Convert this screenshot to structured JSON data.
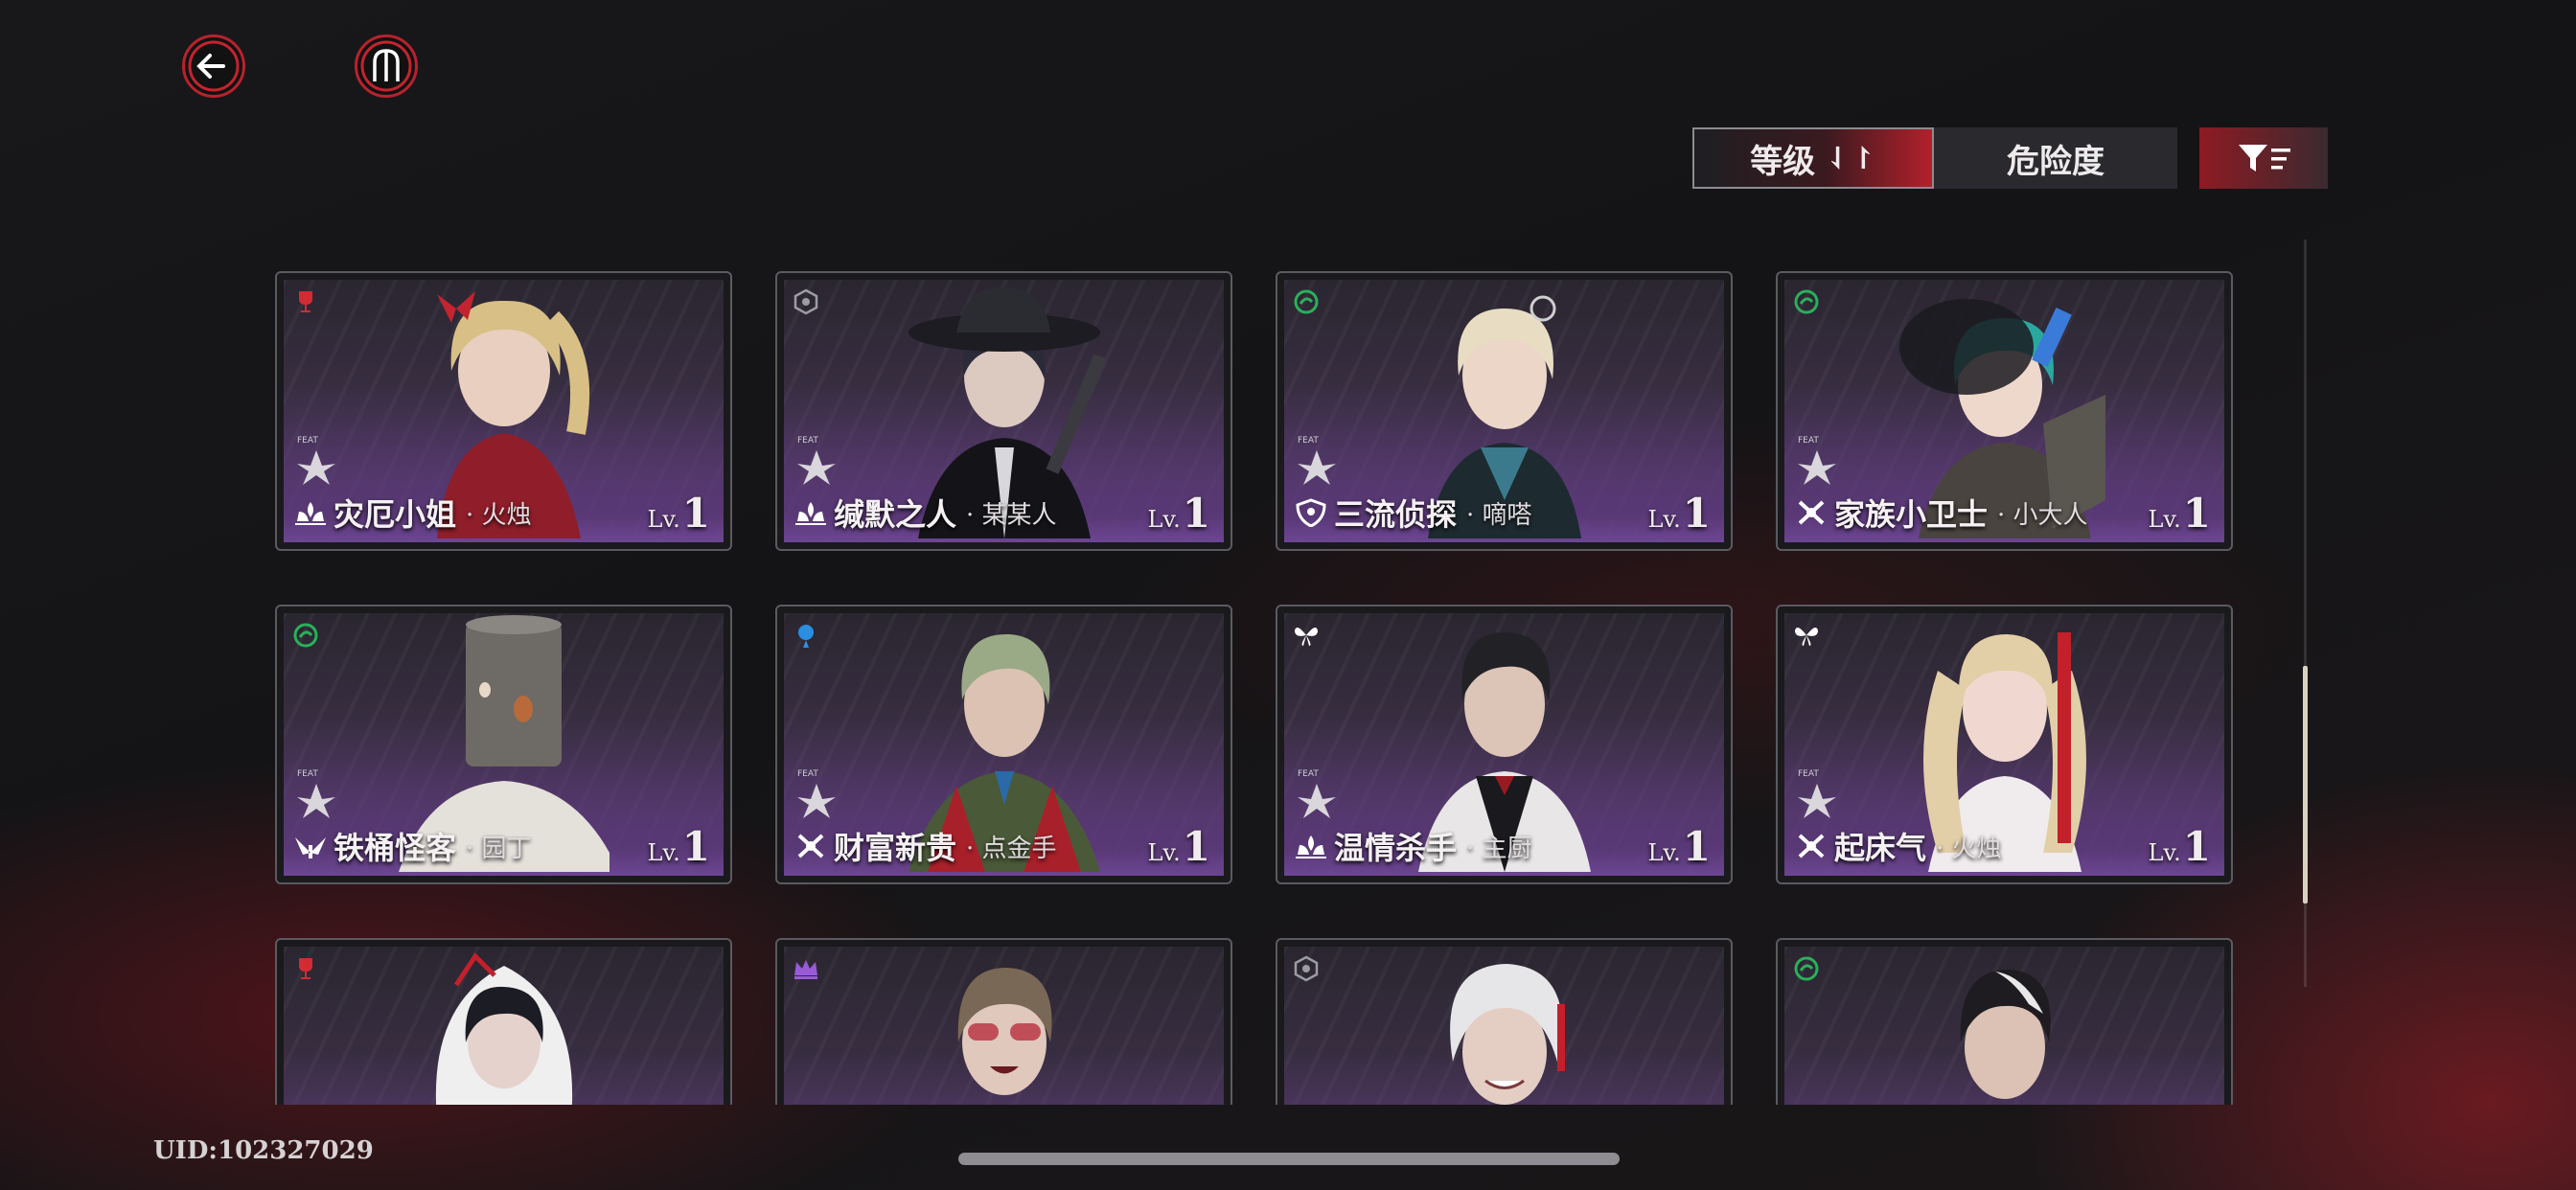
{
  "header": {
    "back_icon": "back-arrow-icon",
    "menu_icon": "trident-menu-icon"
  },
  "sort": {
    "level_label": "等级",
    "level_arrow": "⇃↾",
    "danger_label": "危险度",
    "filter_icon": "filter-list-icon"
  },
  "characters": [
    {
      "name": "灾厄小姐",
      "sub": "· 火烛",
      "level_prefix": "Lv.",
      "level": "1",
      "faction_icon": "red-goblet-icon",
      "role_icon": "flame-lotus-icon",
      "accent": "#d32a33"
    },
    {
      "name": "缄默之人",
      "sub": "· 某某人",
      "level_prefix": "Lv.",
      "level": "1",
      "faction_icon": "grey-badge-icon",
      "role_icon": "flame-lotus-icon",
      "accent": "#9c9ca4"
    },
    {
      "name": "三流侦探",
      "sub": "· 嘀嗒",
      "level_prefix": "Lv.",
      "level": "1",
      "faction_icon": "green-swirl-icon",
      "role_icon": "shield-face-icon",
      "accent": "#2ab05a"
    },
    {
      "name": "家族小卫士",
      "sub": "· 小大人",
      "level_prefix": "Lv.",
      "level": "1",
      "faction_icon": "green-swirl-icon",
      "role_icon": "crossed-blades-icon",
      "accent": "#2ab05a"
    },
    {
      "name": "铁桶怪客",
      "sub": "· 园丁",
      "level_prefix": "Lv.",
      "level": "1",
      "faction_icon": "green-swirl-icon",
      "role_icon": "wings-icon",
      "accent": "#2ab05a"
    },
    {
      "name": "财富新贵",
      "sub": "· 点金手",
      "level_prefix": "Lv.",
      "level": "1",
      "faction_icon": "blue-orb-icon",
      "role_icon": "crossed-blades-icon",
      "accent": "#2a8fe0"
    },
    {
      "name": "温情杀手",
      "sub": "· 主厨",
      "level_prefix": "Lv.",
      "level": "1",
      "faction_icon": "white-butterfly-icon",
      "role_icon": "flame-lotus-icon",
      "accent": "#ffffff"
    },
    {
      "name": "起床气",
      "sub": "· 火烛",
      "level_prefix": "Lv.",
      "level": "1",
      "faction_icon": "white-butterfly-icon",
      "role_icon": "crossed-blades-icon",
      "accent": "#ffffff"
    },
    {
      "name": "",
      "sub": "",
      "level_prefix": "",
      "level": "",
      "faction_icon": "red-goblet-icon",
      "role_icon": "",
      "accent": "#d32a33"
    },
    {
      "name": "",
      "sub": "",
      "level_prefix": "",
      "level": "",
      "faction_icon": "purple-crown-icon",
      "role_icon": "",
      "accent": "#9a5ad8"
    },
    {
      "name": "",
      "sub": "",
      "level_prefix": "",
      "level": "",
      "faction_icon": "grey-badge-icon",
      "role_icon": "",
      "accent": "#9c9ca4"
    },
    {
      "name": "",
      "sub": "",
      "level_prefix": "",
      "level": "",
      "faction_icon": "green-swirl-icon",
      "role_icon": "",
      "accent": "#2ab05a"
    }
  ],
  "footer": {
    "uid": "UID:102327029"
  }
}
